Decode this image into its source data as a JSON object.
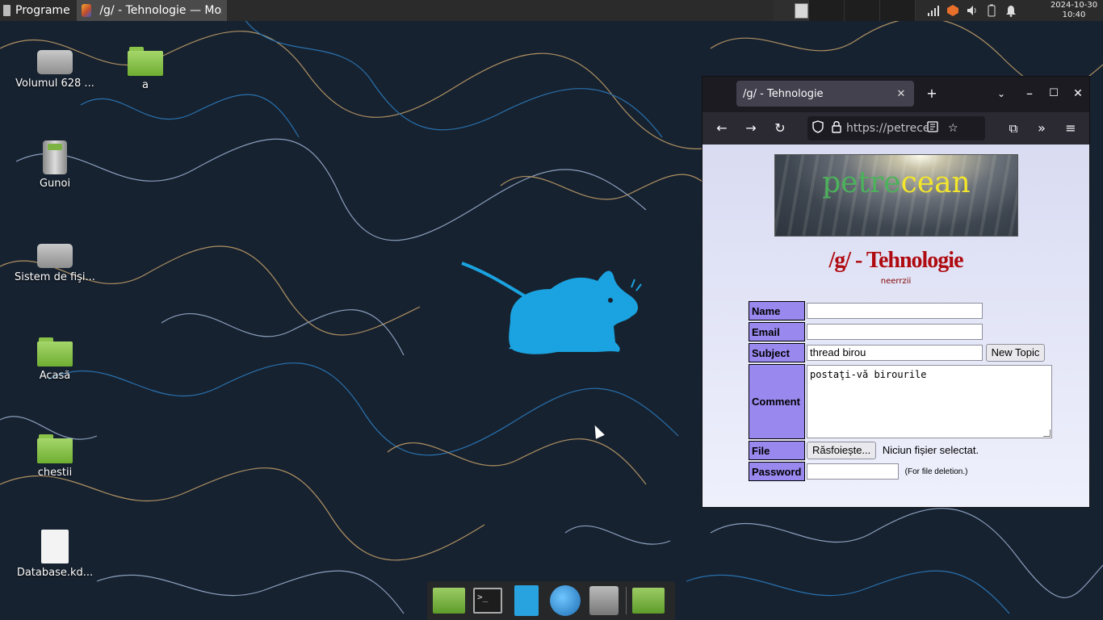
{
  "panel": {
    "menu_label": "Programe",
    "task_title": "/g/ - Tehnologie — Mozilla...",
    "clock_date": "2024-10-30",
    "clock_time": "10:40"
  },
  "desktop": {
    "icons": [
      {
        "label": "Volumul 628 ...",
        "icon": "drive-icon"
      },
      {
        "label": "a",
        "icon": "folder-icon"
      },
      {
        "label": "Gunoi",
        "icon": "trash-icon"
      },
      {
        "label": "Sistem de fişi...",
        "icon": "drive-icon"
      },
      {
        "label": "Acasă",
        "icon": "home-folder-icon"
      },
      {
        "label": "chestii",
        "icon": "folder-icon"
      },
      {
        "label": "Database.kd...",
        "icon": "document-icon"
      }
    ]
  },
  "dock": {
    "terminal_glyph": ">_"
  },
  "browser": {
    "tab_title": "/g/ - Tehnologie",
    "url": "https://petrecean",
    "colors": {
      "frame": "#1c1b22",
      "toolbar": "#2b2a33",
      "tab": "#42414d"
    }
  },
  "page": {
    "logo_part1": "petre",
    "logo_part2": "cean",
    "board_title": "/g/ - Tehnologie",
    "board_subtitle": "neerrzii",
    "form": {
      "name_label": "Name",
      "email_label": "Email",
      "subject_label": "Subject",
      "subject_value": "thread birou",
      "new_topic_button": "New Topic",
      "comment_label": "Comment",
      "comment_value": "postaţi-vă birourile",
      "file_label": "File",
      "browse_button": "Răsfoiește...",
      "no_file_text": "Niciun fișier selectat.",
      "password_label": "Password",
      "password_note": "(For file deletion.)"
    },
    "colors": {
      "label_bg": "#9988ee",
      "title": "#af0a0f"
    }
  }
}
